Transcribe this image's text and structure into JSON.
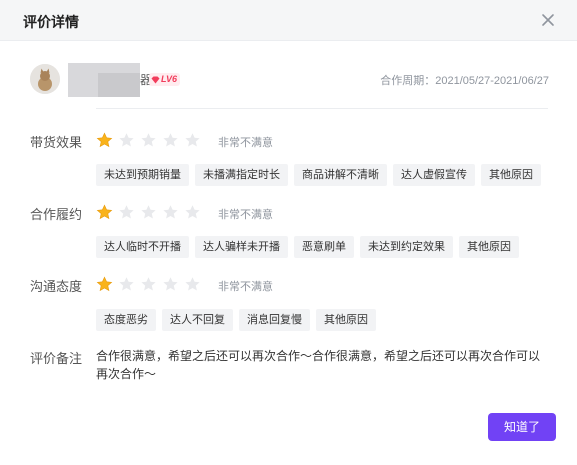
{
  "dialog": {
    "title": "评价详情"
  },
  "user": {
    "name_tail": "器",
    "level": "LV6",
    "period": "合作周期：2021/05/27-2021/06/27"
  },
  "ratings": [
    {
      "label": "带货效果",
      "stars": 1,
      "max": 5,
      "text": "非常不满意",
      "tags": [
        "未达到预期销量",
        "未播满指定时长",
        "商品讲解不清晰",
        "达人虚假宣传",
        "其他原因"
      ]
    },
    {
      "label": "合作履约",
      "stars": 1,
      "max": 5,
      "text": "非常不满意",
      "tags": [
        "达人临时不开播",
        "达人骗样未开播",
        "恶意刷单",
        "未达到约定效果",
        "其他原因"
      ]
    },
    {
      "label": "沟通态度",
      "stars": 1,
      "max": 5,
      "text": "非常不满意",
      "tags": [
        "态度恶劣",
        "达人不回复",
        "消息回复慢",
        "其他原因"
      ]
    }
  ],
  "remark": {
    "label": "评价备注",
    "text": "合作很满意，希望之后还可以再次合作～合作很满意，希望之后还可以再次合作可以再次合作～"
  },
  "footer": {
    "confirm_label": "知道了"
  },
  "colors": {
    "accent": "#7142f5",
    "star_on": "#f9b31b",
    "star_off": "#e8e9ec"
  }
}
